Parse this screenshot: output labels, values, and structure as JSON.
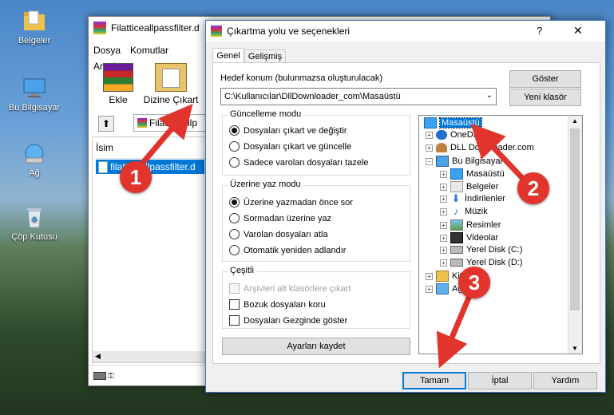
{
  "desktop": {
    "icons": [
      {
        "label": "Belgeler"
      },
      {
        "label": "Bu Bilgisayar"
      },
      {
        "label": "Ağ"
      },
      {
        "label": "Çöp Kutusu"
      }
    ]
  },
  "bg_window": {
    "title": "Filatticeallpassfilter.d",
    "menu": [
      "Dosya",
      "Komutlar",
      "Araçla"
    ],
    "toolbar": {
      "add_label": "Ekle",
      "extract_label": "Dizine Çıkart"
    },
    "path_value": "Filatticeallp",
    "column_name": "İsim",
    "file_name": "filatticeallpassfilter.d"
  },
  "dialog": {
    "title": "Çıkartma yolu ve seçenekleri",
    "help_symbol": "?",
    "close_symbol": "✕",
    "tabs": [
      "Genel",
      "Gelişmiş"
    ],
    "dest_label": "Hedef konum (bulunmazsa oluşturulacak)",
    "dest_value": "C:\\Kullanıcılar\\DllDownloader_com\\Masaüstü",
    "show_button": "Göster",
    "new_folder_button": "Yeni klasör",
    "update_group": {
      "title": "Güncelleme modu",
      "options": [
        "Dosyaları çıkart ve değiştir",
        "Dosyaları çıkart ve güncelle",
        "Sadece varolan dosyaları tazele"
      ],
      "selected": 0
    },
    "overwrite_group": {
      "title": "Üzerine yaz modu",
      "options": [
        "Üzerine yazmadan önce sor",
        "Sormadan üzerine yaz",
        "Varolan dosyaları atla",
        "Otomatik yeniden adlandır"
      ],
      "selected": 0
    },
    "misc_group": {
      "title": "Çeşitli",
      "options": [
        "Arşivleri alt klasörlere çıkart",
        "Bozuk dosyaları koru",
        "Dosyaları Gezginde göster"
      ]
    },
    "save_settings_button": "Ayarları kaydet",
    "tree": [
      {
        "label": "Masaüstü"
      },
      {
        "label": "OneDrive"
      },
      {
        "label": "DLL Downloader.com"
      },
      {
        "label": "Bu Bilgisayar"
      },
      {
        "label": "Masaüstü"
      },
      {
        "label": "Belgeler"
      },
      {
        "label": "İndirilenler"
      },
      {
        "label": "Müzik"
      },
      {
        "label": "Resimler"
      },
      {
        "label": "Videolar"
      },
      {
        "label": "Yerel Disk (C:)"
      },
      {
        "label": "Yerel Disk (D:)"
      },
      {
        "label": "Kit"
      },
      {
        "label": "Ağ"
      }
    ],
    "ok_button": "Tamam",
    "cancel_button": "İptal",
    "help_button": "Yardım"
  },
  "callouts": [
    "1",
    "2",
    "3"
  ],
  "colors": {
    "accent": "#0078d7",
    "callout": "#e0342c",
    "selection": "#0078d7"
  }
}
